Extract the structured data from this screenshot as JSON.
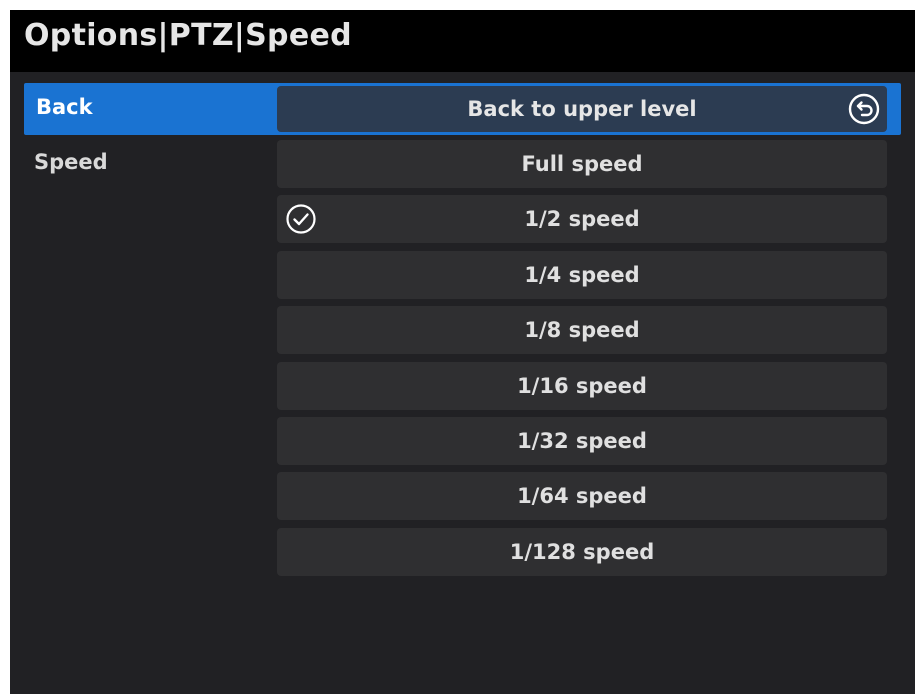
{
  "title": "Options|PTZ|Speed",
  "back_row": {
    "label": "Back",
    "button_label": "Back to upper level",
    "icon": "return-arrow-icon"
  },
  "speed_row": {
    "label": "Speed",
    "selected": "1/2 speed",
    "selected_icon": "check-circle-icon",
    "options": [
      "Full speed",
      "1/2 speed",
      "1/4 speed",
      "1/8 speed",
      "1/16 speed",
      "1/32 speed",
      "1/64 speed",
      "1/128 speed"
    ]
  },
  "colors": {
    "background": "#212124",
    "title_bar": "#000000",
    "highlight": "#1a73d2",
    "button": "#2f2f31",
    "text": "#e0e0e0"
  }
}
